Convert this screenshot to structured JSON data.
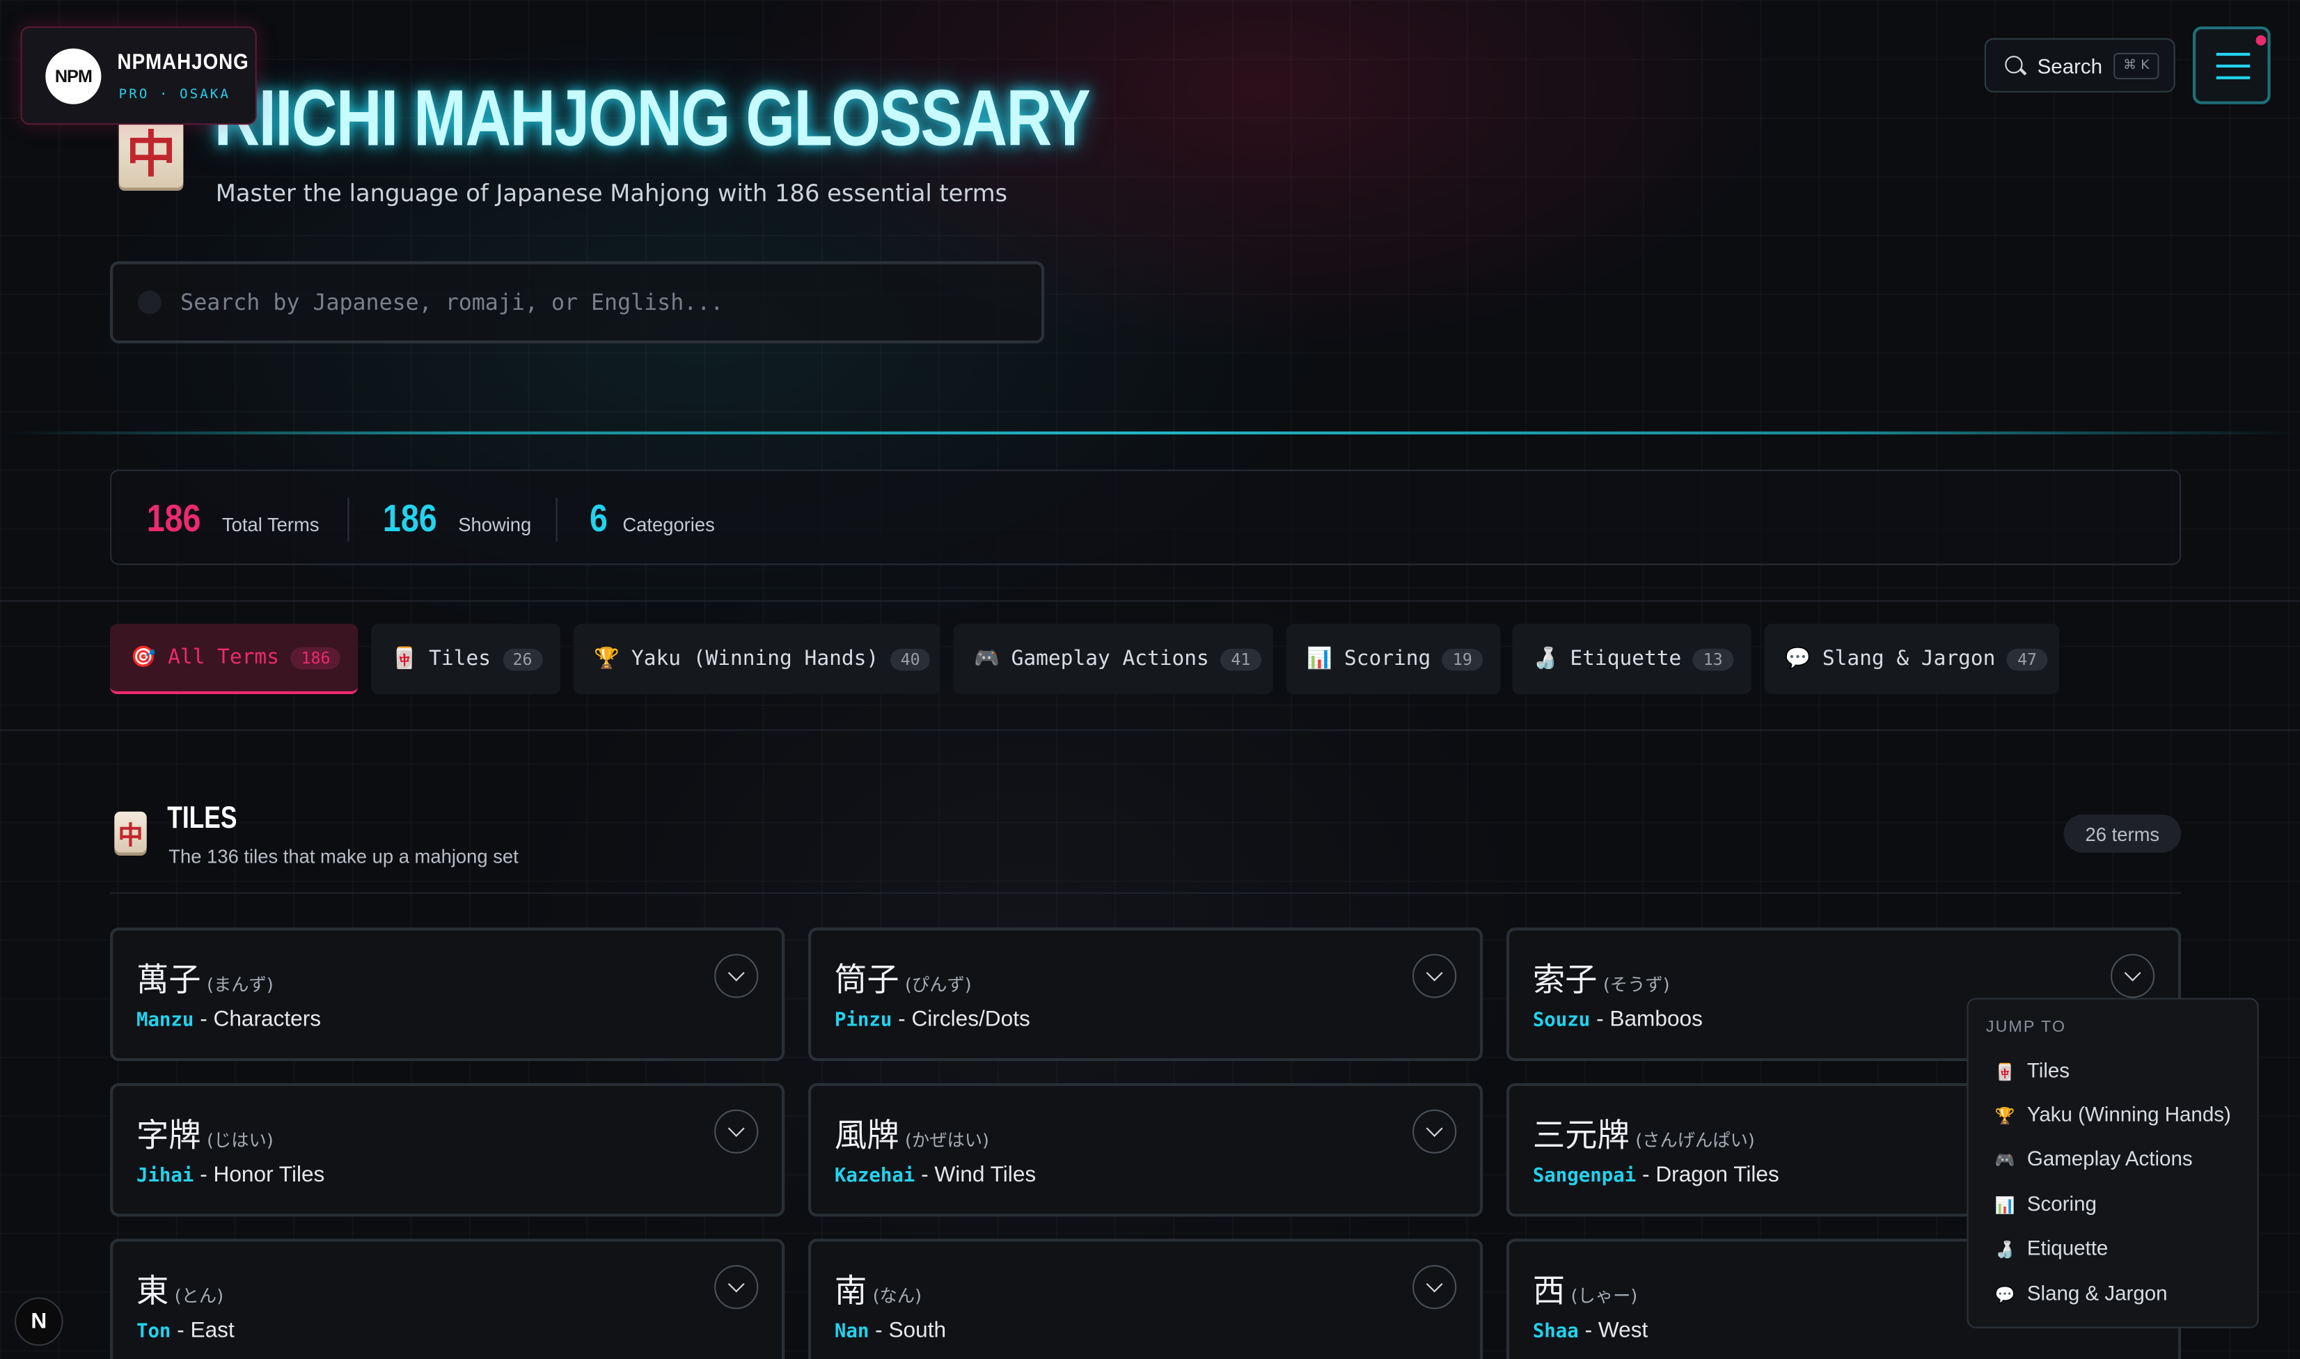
{
  "brand": {
    "logo": "NPM",
    "name": "NPMAHJONG",
    "sub": "PRO · OSAKA"
  },
  "header": {
    "tile": "中",
    "title": "RIICHI MAHJONG GLOSSARY",
    "subtitle": "Master the language of Japanese Mahjong with 186 essential terms",
    "search_placeholder": "Search by Japanese, romaji, or English..."
  },
  "topbar": {
    "search_label": "Search",
    "shortcut": "⌘ K"
  },
  "stats": [
    {
      "value": "186",
      "label": "Total Terms",
      "color": "#ec2a6e"
    },
    {
      "value": "186",
      "label": "Showing",
      "color": "#22d3ee"
    },
    {
      "value": "6",
      "label": "Categories",
      "color": "#22d3ee"
    }
  ],
  "tabs": [
    {
      "icon": "🎯",
      "label": "All Terms",
      "count": "186"
    },
    {
      "icon": "🀄",
      "label": "Tiles",
      "count": "26"
    },
    {
      "icon": "🏆",
      "label": "Yaku (Winning Hands)",
      "count": "40"
    },
    {
      "icon": "🎮",
      "label": "Gameplay Actions",
      "count": "41"
    },
    {
      "icon": "📊",
      "label": "Scoring",
      "count": "19"
    },
    {
      "icon": "🍶",
      "label": "Etiquette",
      "count": "13"
    },
    {
      "icon": "💬",
      "label": "Slang & Jargon",
      "count": "47"
    }
  ],
  "section": {
    "icon": "中",
    "title": "TILES",
    "subtitle": "The 136 tiles that make up a mahjong set",
    "count": "26 terms"
  },
  "cards": [
    {
      "jp": "萬子",
      "kana": "(まんず)",
      "romaji": "Manzu",
      "en": "- Characters"
    },
    {
      "jp": "筒子",
      "kana": "(ぴんず)",
      "romaji": "Pinzu",
      "en": "- Circles/Dots"
    },
    {
      "jp": "索子",
      "kana": "(そうず)",
      "romaji": "Souzu",
      "en": "- Bamboos"
    },
    {
      "jp": "字牌",
      "kana": "(じはい)",
      "romaji": "Jihai",
      "en": "- Honor Tiles"
    },
    {
      "jp": "風牌",
      "kana": "(かぜはい)",
      "romaji": "Kazehai",
      "en": "- Wind Tiles"
    },
    {
      "jp": "三元牌",
      "kana": "(さんげんぱい)",
      "romaji": "Sangenpai",
      "en": "- Dragon Tiles"
    },
    {
      "jp": "東",
      "kana": "(とん)",
      "romaji": "Ton",
      "en": "- East"
    },
    {
      "jp": "南",
      "kana": "(なん)",
      "romaji": "Nan",
      "en": "- South"
    },
    {
      "jp": "西",
      "kana": "(しゃー)",
      "romaji": "Shaa",
      "en": "- West"
    }
  ],
  "jump": {
    "title": "JUMP TO",
    "items": [
      {
        "icon": "🀄",
        "label": "Tiles"
      },
      {
        "icon": "🏆",
        "label": "Yaku (Winning Hands)"
      },
      {
        "icon": "🎮",
        "label": "Gameplay Actions"
      },
      {
        "icon": "📊",
        "label": "Scoring"
      },
      {
        "icon": "🍶",
        "label": "Etiquette"
      },
      {
        "icon": "💬",
        "label": "Slang & Jargon"
      }
    ]
  },
  "dev_badge": "N"
}
